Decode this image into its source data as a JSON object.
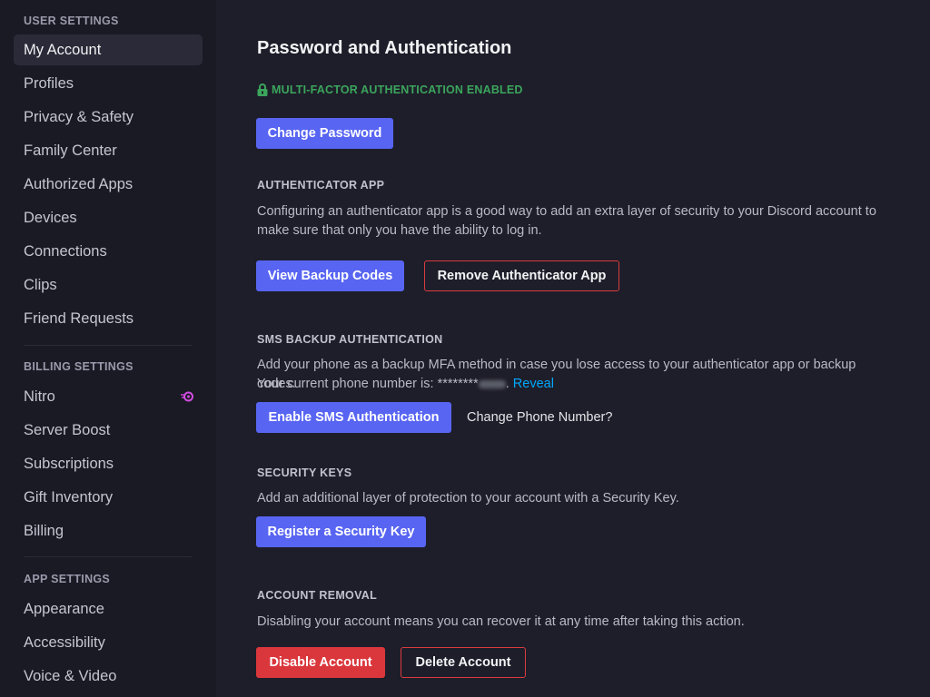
{
  "sidebar": {
    "user_settings_header": "USER SETTINGS",
    "user_items": [
      {
        "label": "My Account",
        "active": true
      },
      {
        "label": "Profiles"
      },
      {
        "label": "Privacy & Safety"
      },
      {
        "label": "Family Center"
      },
      {
        "label": "Authorized Apps"
      },
      {
        "label": "Devices"
      },
      {
        "label": "Connections"
      },
      {
        "label": "Clips"
      },
      {
        "label": "Friend Requests"
      }
    ],
    "billing_settings_header": "BILLING SETTINGS",
    "billing_items": [
      {
        "label": "Nitro",
        "icon": "nitro-icon"
      },
      {
        "label": "Server Boost"
      },
      {
        "label": "Subscriptions"
      },
      {
        "label": "Gift Inventory"
      },
      {
        "label": "Billing"
      }
    ],
    "app_settings_header": "APP SETTINGS",
    "app_items": [
      {
        "label": "Appearance"
      },
      {
        "label": "Accessibility"
      },
      {
        "label": "Voice & Video"
      }
    ]
  },
  "main": {
    "title": "Password and Authentication",
    "mfa_status": "MULTI-FACTOR AUTHENTICATION ENABLED",
    "change_password": "Change Password",
    "authenticator": {
      "header": "AUTHENTICATOR APP",
      "description": "Configuring an authenticator app is a good way to add an extra layer of security to your Discord account to make sure that only you have the ability to log in.",
      "view_backup_codes": "View Backup Codes",
      "remove_app": "Remove Authenticator App"
    },
    "sms": {
      "header": "SMS BACKUP AUTHENTICATION",
      "description": "Add your phone as a backup MFA method in case you lose access to your authenticator app or backup codes.",
      "phone_prefix": "Your current phone number is: ",
      "phone_masked": "********",
      "reveal": "Reveal",
      "enable": "Enable SMS Authentication",
      "change_phone": "Change Phone Number?"
    },
    "security_keys": {
      "header": "SECURITY KEYS",
      "description": "Add an additional layer of protection to your account with a Security Key.",
      "register": "Register a Security Key"
    },
    "account_removal": {
      "header": "ACCOUNT REMOVAL",
      "description": "Disabling your account means you can recover it at any time after taking this action.",
      "disable": "Disable Account",
      "delete": "Delete Account"
    }
  },
  "colors": {
    "accent": "#5865f2",
    "danger": "#da373c",
    "success": "#3ba55c",
    "link": "#00a8fc",
    "nitro": "#d14ce0"
  }
}
